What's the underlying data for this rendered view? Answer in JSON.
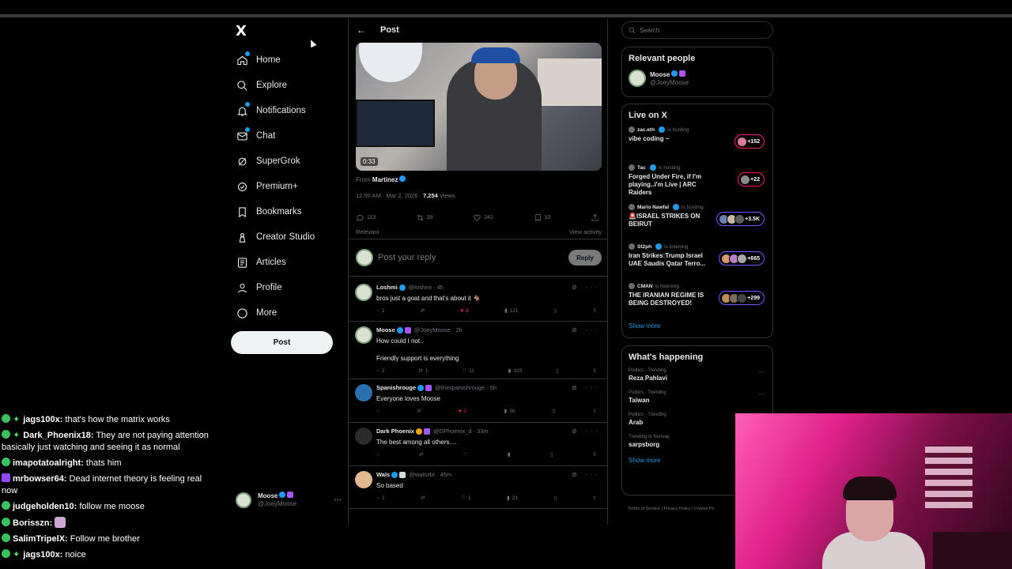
{
  "nav": {
    "logo": "X",
    "items": [
      {
        "label": "Home",
        "icon": "home-icon"
      },
      {
        "label": "Explore",
        "icon": "search-icon"
      },
      {
        "label": "Notifications",
        "icon": "bell-icon"
      },
      {
        "label": "Chat",
        "icon": "mail-icon"
      },
      {
        "label": "SuperGrok",
        "icon": "grok-icon"
      },
      {
        "label": "Premium+",
        "icon": "premium-icon"
      },
      {
        "label": "Bookmarks",
        "icon": "bookmark-icon"
      },
      {
        "label": "Creator Studio",
        "icon": "creator-icon"
      },
      {
        "label": "Articles",
        "icon": "articles-icon"
      },
      {
        "label": "Profile",
        "icon": "profile-icon"
      },
      {
        "label": "More",
        "icon": "more-icon"
      }
    ],
    "post_label": "Post",
    "account": {
      "name": "Moose",
      "handle": "@JoeyMoose"
    }
  },
  "post": {
    "header": "Post",
    "video_time": "0:33",
    "from_prefix": "From",
    "from_name": "Martinez",
    "timestamp": "12:50 AM · Mar 2, 2026 · ",
    "views_count": "7,254",
    "views_label": " Views",
    "stats": {
      "replies": "113",
      "reposts": "39",
      "likes": "241",
      "bookmarks": "10"
    },
    "sort_label": "Relevant",
    "activity_label": "View activity",
    "reply_placeholder": "Post your reply",
    "reply_button": "Reply"
  },
  "replies": [
    {
      "name": "Loshmi",
      "handle": "@loshmi · 4h",
      "text": "bros just a goat and that's about it 🐐",
      "replies": "1",
      "reposts": "",
      "likes": "8",
      "views": "121",
      "liked": true
    },
    {
      "name": "Moose",
      "handle": "@JoeyMoose · 2h",
      "text": "How could I not..",
      "text2": "Friendly support is everything",
      "replies": "2",
      "reposts": "1",
      "likes": "11",
      "views": "103",
      "liked": false
    },
    {
      "name": "Spanishrouge",
      "handle": "@thespanishrouge · 5h",
      "text": "Everyone loves Moose",
      "replies": "",
      "reposts": "",
      "likes": "2",
      "views": "36",
      "liked": true
    },
    {
      "name": "Dark Phoenix",
      "handle": "@DPhoenix_d · 33m",
      "text": "The best among all others....",
      "replies": "",
      "reposts": "",
      "likes": "",
      "views": "",
      "liked": false
    },
    {
      "name": "Wals",
      "handle": "@walsxbt · 45m",
      "text": "So based",
      "replies": "1",
      "reposts": "",
      "likes": "1",
      "views": "21",
      "liked": false
    }
  ],
  "right": {
    "search_placeholder": "Search",
    "relevant_title": "Relevant people",
    "relevant": {
      "name": "Moose",
      "handle": "@JoeyMoose"
    },
    "live_title": "Live on X",
    "live": [
      {
        "host": "zac.eth",
        "status": "is hosting",
        "title": "vibe coding ~",
        "count": "+152"
      },
      {
        "host": "Tac",
        "status": "is hosting",
        "title": "Forged Under Fire, if I'm playing..i'm Live | ARC Raiders",
        "count": "+22"
      },
      {
        "host": "Mario Nawfal",
        "status": "is hosting",
        "title": "🚨ISRAEL STRIKES ON BEIRUT",
        "count": "+3.5K"
      },
      {
        "host": "St2ph",
        "status": "is listening",
        "title": "Iran Strikes:Trump Israel UAE Saudis Qatar Terro...",
        "count": "+665"
      },
      {
        "host": "CMAN",
        "status": "is listening",
        "title": "THE IRANIAN REGIME IS BEING DESTROYED!",
        "count": "+299"
      }
    ],
    "show_more": "Show more",
    "happening_title": "What's happening",
    "trends": [
      {
        "cat": "Politics · Trending",
        "title": "Reza Pahlavi"
      },
      {
        "cat": "Politics · Trending",
        "title": "Taiwan"
      },
      {
        "cat": "Politics · Trending",
        "title": "Arab"
      },
      {
        "cat": "Trending in Norway",
        "title": "sarpsborg"
      }
    ],
    "footer": "Terms of Service  |  Privacy Policy  |  Cookie Po"
  },
  "chat": [
    {
      "user": "jags100x:",
      "text": " that's how the matrix works",
      "star": true,
      "badge": "green"
    },
    {
      "user": "Dark_Phoenix18:",
      "text": " They are not paying attention basically just watching and seeing it as normal",
      "star": true,
      "badge": "green"
    },
    {
      "user": "imapotatoalright:",
      "text": " thats him",
      "star": false,
      "badge": "green"
    },
    {
      "user": "mrbowser64:",
      "text": " Dead internet theory is feeling real now",
      "star": false,
      "badge": "twitch"
    },
    {
      "user": "judgeholden10:",
      "text": " follow me moose",
      "star": false,
      "badge": "green"
    },
    {
      "user": "Borisszn:",
      "text": " ",
      "star": false,
      "badge": "green",
      "emote": true
    },
    {
      "user": "SalimTripelX:",
      "text": " Follow me brother",
      "star": false,
      "badge": "green"
    },
    {
      "user": "jags100x:",
      "text": " noice",
      "star": true,
      "badge": "green"
    }
  ]
}
